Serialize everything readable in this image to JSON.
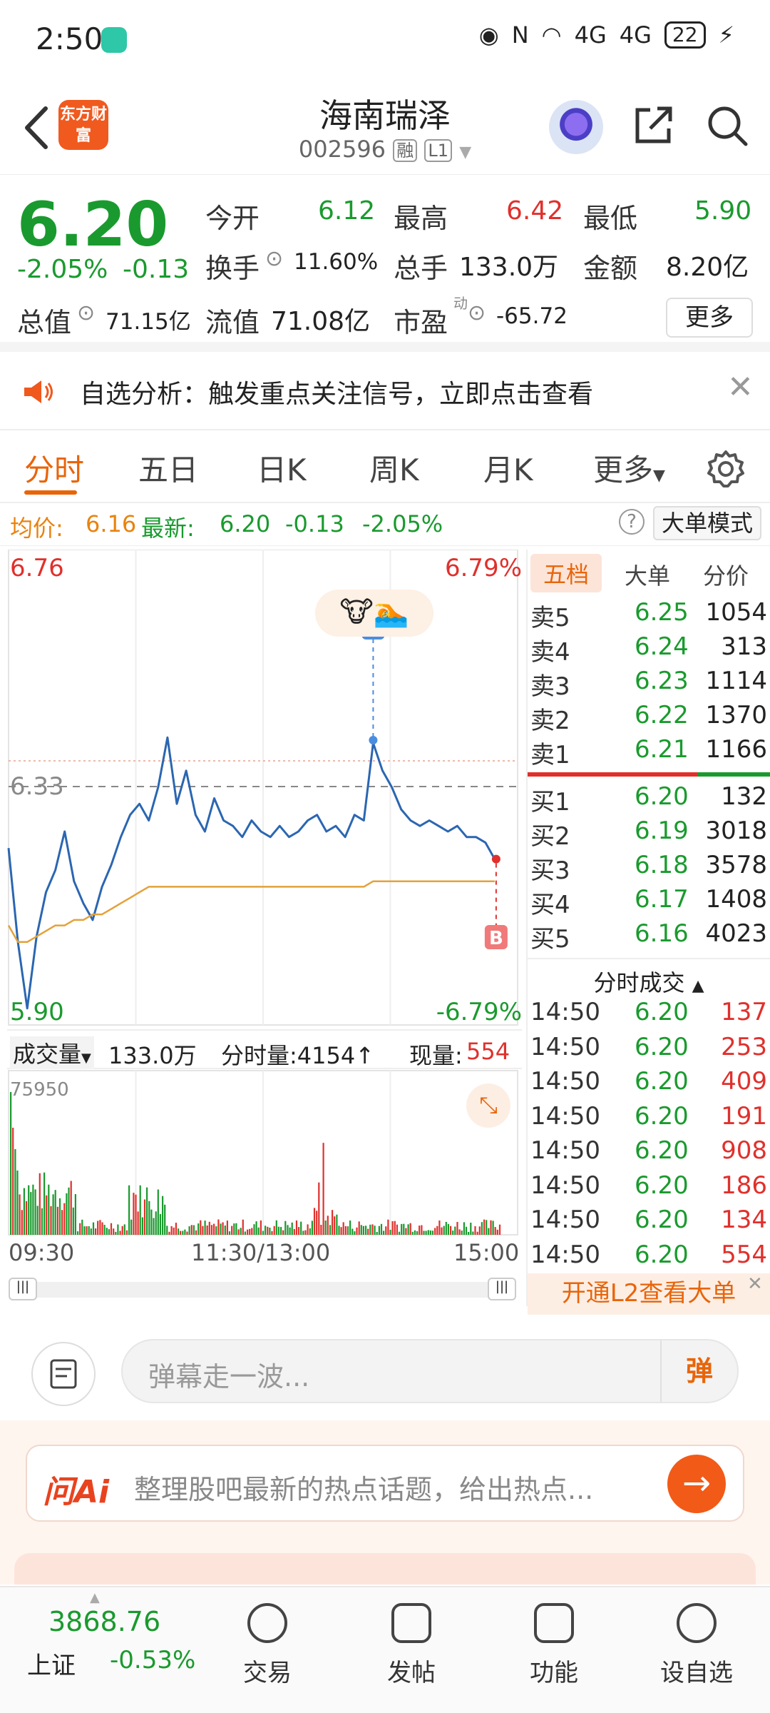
{
  "status_bar": {
    "time": "2:50",
    "network": "4G",
    "network2": "4G",
    "battery": "22"
  },
  "header": {
    "back_icon": "back-arrow-icon",
    "brand_logo_text": "东方财富",
    "stock_name": "海南瑞泽",
    "stock_code": "002596",
    "tag_margin": "融",
    "tag_level": "L1"
  },
  "quote": {
    "price": "6.20",
    "change_pct": "-2.05%",
    "change": "-0.13",
    "open_label": "今开",
    "open": "6.12",
    "high_label": "最高",
    "high": "6.42",
    "low_label": "最低",
    "low": "5.90",
    "turnover_label": "换手",
    "turnover": "11.60%",
    "volume_label": "总手",
    "volume": "133.0万",
    "amount_label": "金额",
    "amount": "8.20亿",
    "mktcap_label": "总值",
    "mktcap": "71.15亿",
    "float_label": "流值",
    "float": "71.08亿",
    "pe_label": "市盈",
    "pe_super": "动",
    "pe": "-65.72",
    "more_label": "更多"
  },
  "notice": {
    "text": "自选分析：触发重点关注信号，立即点击查看"
  },
  "tabs": [
    "分时",
    "五日",
    "日K",
    "周K",
    "月K",
    "更多"
  ],
  "info_line": {
    "avg_label": "均价:",
    "avg": "6.16",
    "latest_label": "最新:",
    "latest": "6.20",
    "latest_chg": "-0.13",
    "latest_pct": "-2.05%",
    "mode_label": "大单模式"
  },
  "chart_data": {
    "type": "line",
    "title": "",
    "price_max_label": "6.76",
    "price_min_label": "5.90",
    "pct_max_label": "6.79%",
    "pct_min_label": "-6.79%",
    "ref_label": "6.33",
    "ylim": [
      5.9,
      6.76
    ],
    "x_labels": [
      "09:30",
      "11:30/13:00",
      "15:00"
    ],
    "series": [
      {
        "color": "#2b66b1",
        "values": [
          6.22,
          6.05,
          5.93,
          6.06,
          6.14,
          6.18,
          6.25,
          6.16,
          6.12,
          6.09,
          6.15,
          6.19,
          6.24,
          6.28,
          6.3,
          6.27,
          6.33,
          6.42,
          6.3,
          6.36,
          6.28,
          6.25,
          6.31,
          6.27,
          6.26,
          6.24,
          6.27,
          6.25,
          6.24,
          6.26,
          6.24,
          6.25,
          6.27,
          6.28,
          6.25,
          6.26,
          6.24,
          6.28,
          6.27,
          6.41,
          6.36,
          6.33,
          6.29,
          6.27,
          6.26,
          6.27,
          6.26,
          6.25,
          6.26,
          6.24,
          6.24,
          6.23,
          6.2
        ]
      },
      {
        "color": "#e3a23a",
        "values": [
          6.08,
          6.05,
          6.05,
          6.06,
          6.07,
          6.08,
          6.08,
          6.09,
          6.09,
          6.1,
          6.1,
          6.11,
          6.12,
          6.13,
          6.14,
          6.15,
          6.15,
          6.15,
          6.15,
          6.15,
          6.15,
          6.15,
          6.15,
          6.15,
          6.15,
          6.15,
          6.15,
          6.15,
          6.15,
          6.15,
          6.15,
          6.15,
          6.15,
          6.15,
          6.15,
          6.15,
          6.15,
          6.15,
          6.15,
          6.16,
          6.16,
          6.16,
          6.16,
          6.16,
          6.16,
          6.16,
          6.16,
          6.16,
          6.16,
          6.16,
          6.16,
          6.16,
          6.16
        ]
      }
    ],
    "markers": [
      {
        "label": "S"
      },
      {
        "label": "B"
      }
    ],
    "volume": {
      "label": "成交量",
      "total": "133.0万",
      "bar_label": "分时量:4154↑",
      "now_label": "现量:",
      "now_value": "554",
      "max_label": "75950"
    }
  },
  "order_book": {
    "tabs": [
      "五档",
      "大单",
      "分价"
    ],
    "asks": [
      {
        "label": "卖5",
        "price": "6.25",
        "vol": "1054"
      },
      {
        "label": "卖4",
        "price": "6.24",
        "vol": "313"
      },
      {
        "label": "卖3",
        "price": "6.23",
        "vol": "1114"
      },
      {
        "label": "卖2",
        "price": "6.22",
        "vol": "1370"
      },
      {
        "label": "卖1",
        "price": "6.21",
        "vol": "1166"
      }
    ],
    "bids": [
      {
        "label": "买1",
        "price": "6.20",
        "vol": "132"
      },
      {
        "label": "买2",
        "price": "6.19",
        "vol": "3018"
      },
      {
        "label": "买3",
        "price": "6.18",
        "vol": "3578"
      },
      {
        "label": "买4",
        "price": "6.17",
        "vol": "1408"
      },
      {
        "label": "买5",
        "price": "6.16",
        "vol": "4023"
      }
    ],
    "ticks_title": "分时成交",
    "ticks": [
      {
        "time": "14:50",
        "price": "6.20",
        "vol": "137"
      },
      {
        "time": "14:50",
        "price": "6.20",
        "vol": "253"
      },
      {
        "time": "14:50",
        "price": "6.20",
        "vol": "409"
      },
      {
        "time": "14:50",
        "price": "6.20",
        "vol": "191"
      },
      {
        "time": "14:50",
        "price": "6.20",
        "vol": "908"
      },
      {
        "time": "14:50",
        "price": "6.20",
        "vol": "186"
      },
      {
        "time": "14:50",
        "price": "6.20",
        "vol": "134"
      },
      {
        "time": "14:50",
        "price": "6.20",
        "vol": "554"
      }
    ],
    "l2_banner": "开通L2查看大单"
  },
  "comment": {
    "placeholder": "弹幕走一波...",
    "danmu_label": "弹"
  },
  "ai_bar": {
    "logo": "问Ai",
    "text": "整理股吧最新的热点话题，给出热点..."
  },
  "bottom_nav": {
    "index_value": "3868.76",
    "index_name": "上证",
    "index_change": "-0.53%",
    "items": [
      "交易",
      "发帖",
      "功能",
      "设自选"
    ]
  },
  "colors": {
    "accent": "#e8650a",
    "up": "#e0302c",
    "down": "#1a9a2e",
    "price_line": "#2b66b1",
    "avg_line": "#e3a23a"
  }
}
